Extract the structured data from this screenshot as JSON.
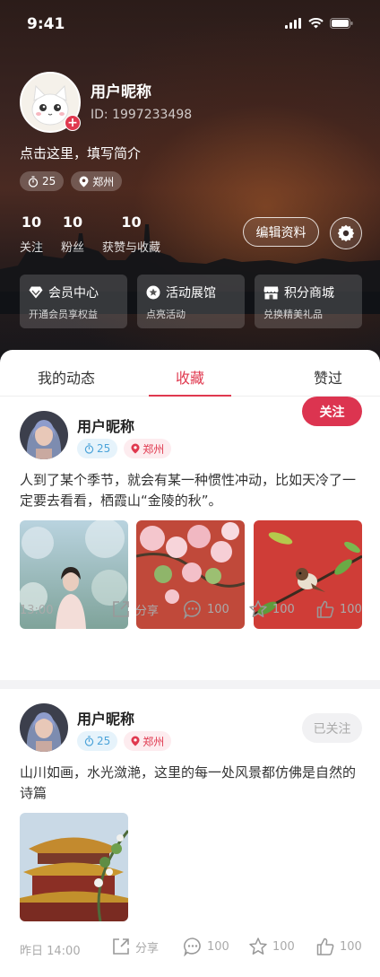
{
  "status_bar": {
    "time": "9:41"
  },
  "profile": {
    "nickname": "用户昵称",
    "id_text": "ID: 1997233498",
    "bio": "点击这里，填写简介",
    "level": "25",
    "city": "郑州",
    "stats": [
      {
        "num": "10",
        "label": "关注"
      },
      {
        "num": "10",
        "label": "粉丝"
      },
      {
        "num": "10",
        "label": "获赞与收藏"
      }
    ],
    "edit_label": "编辑资料"
  },
  "feature_cards": [
    {
      "title": "会员中心",
      "subtitle": "开通会员享权益",
      "icon": "diamond-icon"
    },
    {
      "title": "活动展馆",
      "subtitle": "点亮活动",
      "icon": "star-icon"
    },
    {
      "title": "积分商城",
      "subtitle": "兑换精美礼品",
      "icon": "store-icon"
    }
  ],
  "tabs": [
    {
      "label": "我的动态",
      "active": false
    },
    {
      "label": "收藏",
      "active": true
    },
    {
      "label": "赞过",
      "active": false
    }
  ],
  "posts": [
    {
      "name": "用户昵称",
      "level": "25",
      "city": "郑州",
      "follow_label": "关注",
      "text": "人到了某个季节，就会有某一种惯性冲动，比如天冷了一定要去看看，栖霞山“金陵的秋”。",
      "time": "13:00",
      "share_label": "分享",
      "comments": "100",
      "favorites": "100",
      "likes": "100"
    },
    {
      "name": "用户昵称",
      "level": "25",
      "city": "郑州",
      "follow_label": "已关注",
      "text": "山川如画，水光潋滟，这里的每一处风景都仿佛是自然的诗篇",
      "time": "昨日 14:00",
      "share_label": "分享",
      "comments": "100",
      "favorites": "100",
      "likes": "100"
    }
  ],
  "colors": {
    "accent": "#e0394f",
    "follow_bg": "#dc3450",
    "blue_pill": "#4ba3d9"
  }
}
